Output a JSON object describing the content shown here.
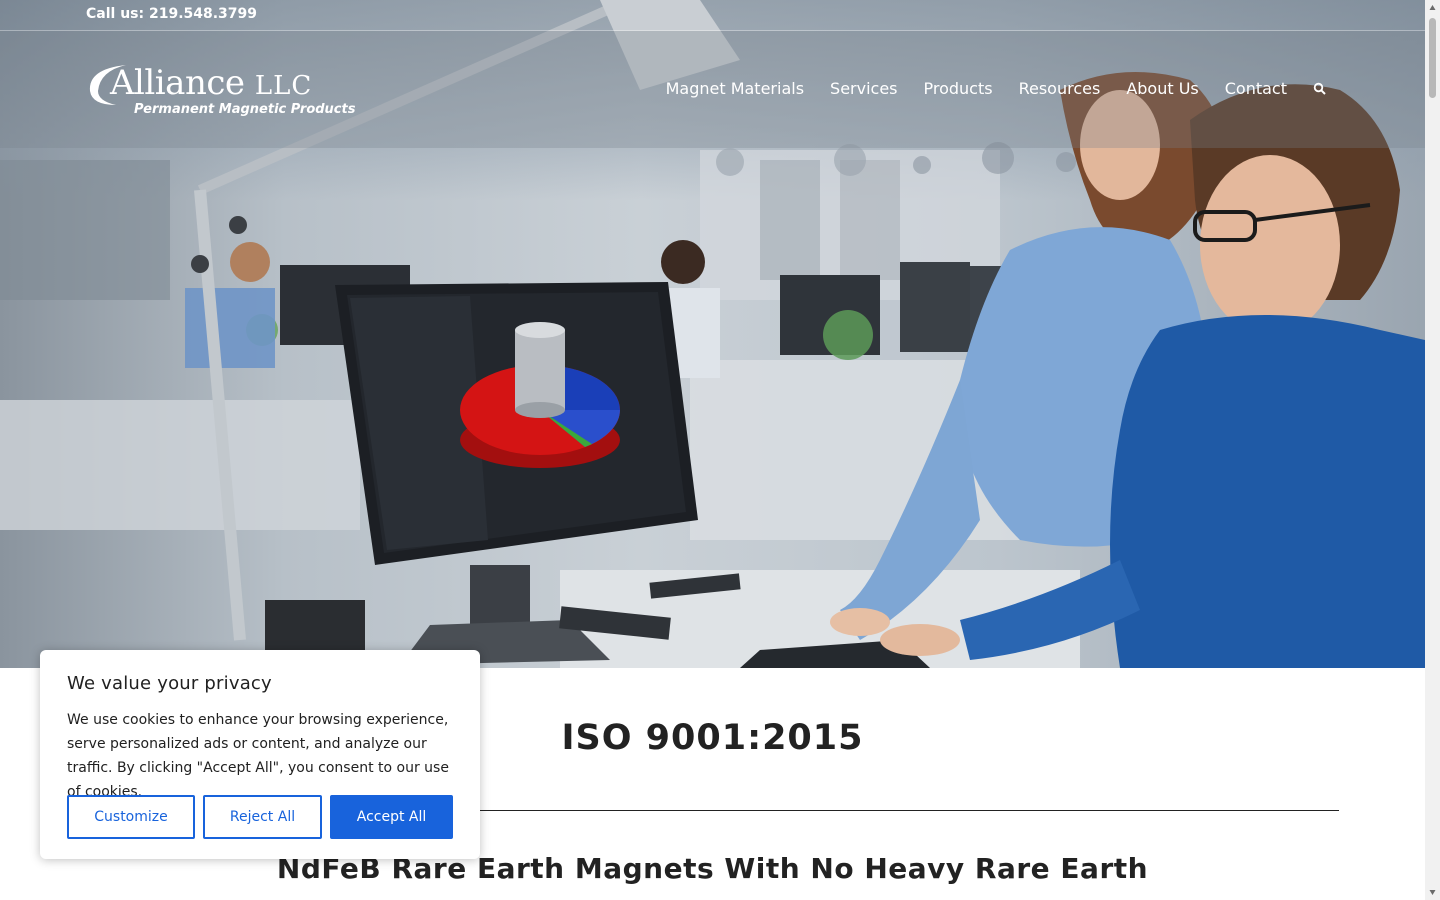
{
  "topbar": {
    "phone": "Call us: 219.548.3799"
  },
  "logo": {
    "brand": "Alliance",
    "suffix": "LLC",
    "tagline": "Permanent Magnetic Products"
  },
  "nav": {
    "items": [
      "Magnet Materials",
      "Services",
      "Products",
      "Resources",
      "About Us",
      "Contact"
    ],
    "search_icon": "search-icon"
  },
  "content": {
    "iso_heading": "ISO 9001:2015",
    "ndfeb_heading": "NdFeB Rare Earth Magnets With No Heavy Rare Earth"
  },
  "cookie": {
    "title": "We value your privacy",
    "body": "We use cookies to enhance your browsing experience, serve personalized ads or content, and analyze our traffic. By clicking \"Accept All\", you consent to our use of cookies.",
    "customize": "Customize",
    "reject": "Reject All",
    "accept": "Accept All"
  },
  "colors": {
    "accent": "#1863dc",
    "text": "#212121",
    "heading": "#222222"
  }
}
